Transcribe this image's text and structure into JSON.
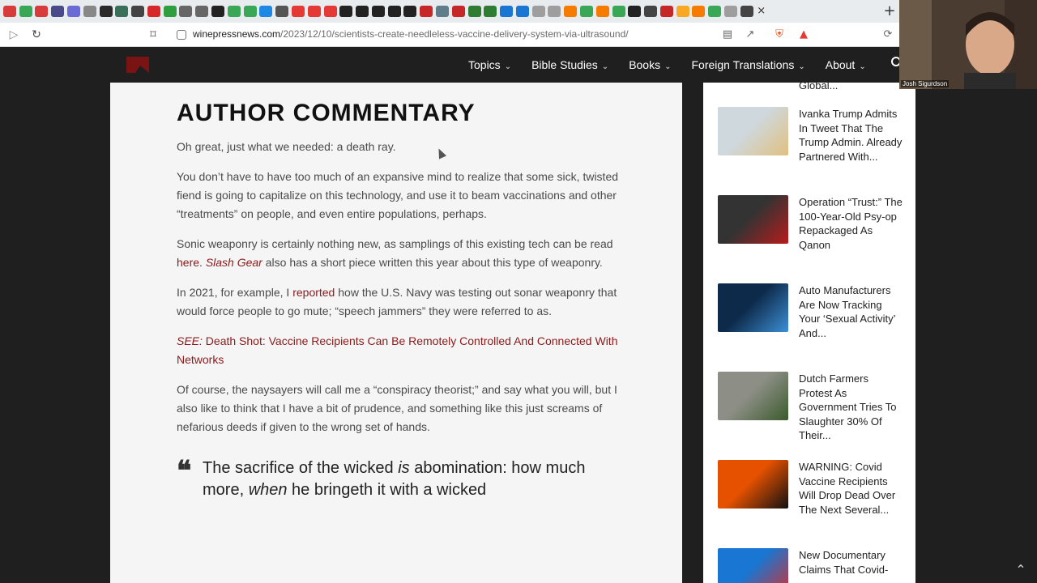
{
  "browser": {
    "url_domain": "winepressnews.com",
    "url_path": "/2023/12/10/scientists-create-needleless-vaccine-delivery-system-via-ultrasound/",
    "tab_close": "×",
    "new_tab": "+",
    "tab_colors": [
      "#d83b3b",
      "#3aa757",
      "#d83b3b",
      "#4a4a8a",
      "#6b6bd6",
      "#888888",
      "#2a2a2a",
      "#3a6f5a",
      "#444444",
      "#d62828",
      "#2e9e3e",
      "#666666",
      "#666666",
      "#222222",
      "#3aa757",
      "#3aa757",
      "#1e88e5",
      "#555555",
      "#e53935",
      "#e53935",
      "#e53935",
      "#222222",
      "#222222",
      "#222222",
      "#222222",
      "#222222",
      "#c62828",
      "#607d8b",
      "#c62828",
      "#2e7d32",
      "#2e7d32",
      "#1976d2",
      "#1976d2",
      "#9e9e9e",
      "#9e9e9e",
      "#f57c00",
      "#3aa757",
      "#f57c00",
      "#3aa757",
      "#222222",
      "#444444",
      "#c62828",
      "#f9a825",
      "#f57c00",
      "#3aa757",
      "#9e9e9e",
      "#444444"
    ]
  },
  "header": {
    "nav": [
      {
        "label": "Topics"
      },
      {
        "label": "Bible Studies"
      },
      {
        "label": "Books"
      },
      {
        "label": "Foreign Translations"
      },
      {
        "label": "About"
      }
    ]
  },
  "article": {
    "heading": "AUTHOR COMMENTARY",
    "p1": "Oh great, just what we needed: a death ray.",
    "p2": "You don’t have to have too much of an expansive mind to realize that some sick, twisted fiend is going to capitalize on this technology, and use it to beam vaccinations and other “treatments” on people, and even entire populations, perhaps.",
    "p3_a": "Sonic weaponry is certainly nothing new, as samplings of this existing tech can be read ",
    "p3_link1": "here",
    "p3_b": ". ",
    "p3_link2": "Slash Gear",
    "p3_c": " also has a short piece written this year about this type of weaponry.",
    "p4_a": "In 2021, for example, I ",
    "p4_link": "reported",
    "p4_b": " how the U.S. Navy was testing out sonar weaponry that would force people to go mute; “speech jammers” they were referred to as.",
    "p5_see": "SEE:",
    "p5_link": " Death Shot: Vaccine Recipients Can Be Remotely Controlled And Connected With Networks",
    "p6": "Of course, the naysayers will call me a “conspiracy theorist;” and say what you will, but I also like to think that I have a bit of prudence, and something like this just screams of nefarious deeds if given to the wrong set of hands.",
    "quote_a": "The sacrifice of the wicked ",
    "quote_i1": "is",
    "quote_b": " abomination: how much more, ",
    "quote_i2": "when",
    "quote_c": " he bringeth it with a wicked"
  },
  "sidebar": {
    "partial": "Global...",
    "items": [
      {
        "title": "Ivanka Trump Admits In Tweet That The Trump Admin. Already Partnered With...",
        "thumb_colors": [
          "#cfd8dc",
          "#e0c080"
        ]
      },
      {
        "title": "Operation “Trust:” The 100-Year-Old Psy-op Repackaged As Qanon",
        "thumb_colors": [
          "#333333",
          "#b71c1c"
        ]
      },
      {
        "title": "Auto Manufacturers Are Now Tracking Your ‘Sexual Activity’ And...",
        "thumb_colors": [
          "#0d2a4a",
          "#3d8fd6"
        ]
      },
      {
        "title": "Dutch Farmers Protest As Government Tries To Slaughter 30% Of Their...",
        "thumb_colors": [
          "#8d8f86",
          "#3b5b2c"
        ]
      },
      {
        "title": "WARNING: Covid Vaccine Recipients Will Drop Dead Over The Next Several...",
        "thumb_colors": [
          "#e65100",
          "#111111"
        ]
      },
      {
        "title": "New Documentary Claims That Covid-",
        "thumb_colors": [
          "#1976d2",
          "#d32f2f"
        ]
      }
    ]
  },
  "webcam": {
    "name": "Josh Sigurdson"
  }
}
